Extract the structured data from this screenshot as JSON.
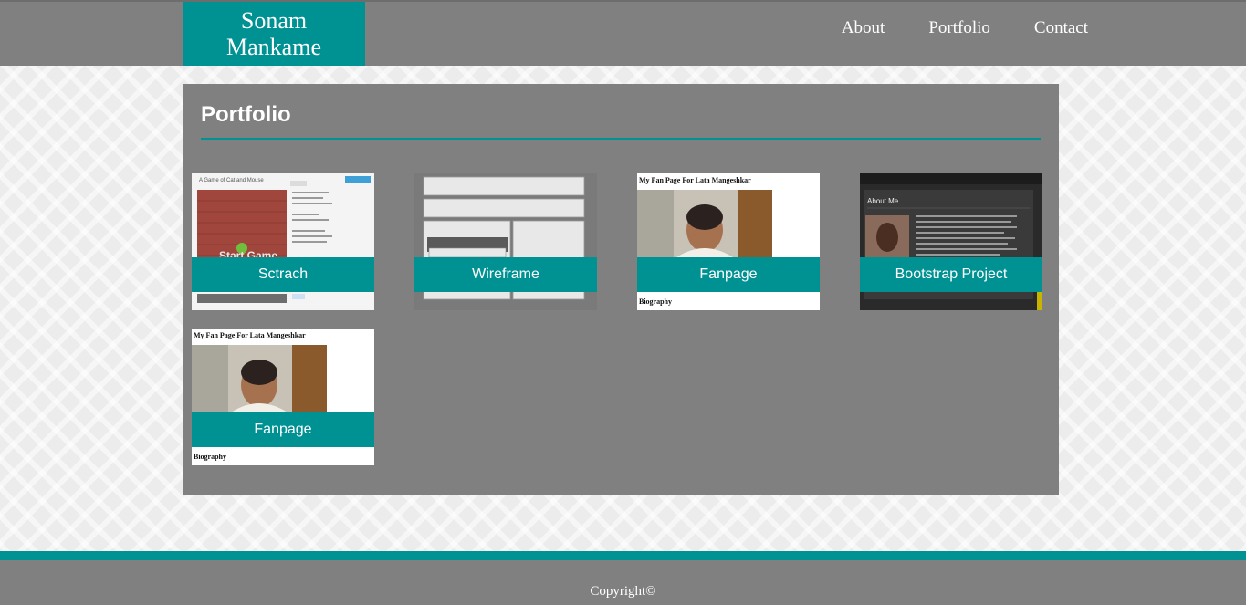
{
  "header": {
    "brand_line1": "Sonam",
    "brand_line2": "Mankame",
    "nav": [
      "About",
      "Portfolio",
      "Contact"
    ]
  },
  "main": {
    "title": "Portfolio",
    "cards": [
      {
        "caption": "Sctrach",
        "thumb_title": "A Game of Cat and Mouse",
        "thumb_overlay": "Start Game"
      },
      {
        "caption": "Wireframe"
      },
      {
        "caption": "Fanpage",
        "thumb_title": "My Fan Page For Lata Mangeshkar",
        "thumb_footer": "Biography"
      },
      {
        "caption": "Bootstrap Project",
        "thumb_heading": "About Me"
      },
      {
        "caption": "Fanpage",
        "thumb_title": "My Fan Page For Lata Mangeshkar",
        "thumb_footer": "Biography"
      }
    ]
  },
  "footer": {
    "copyright": "Copyright©"
  },
  "colors": {
    "accent": "#009193",
    "panel": "#808080",
    "background": "#ececec"
  }
}
